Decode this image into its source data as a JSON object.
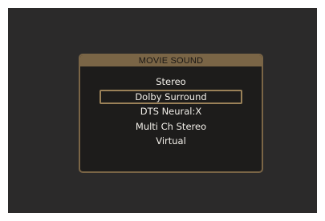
{
  "dialog": {
    "title": "MOVIE SOUND",
    "items": [
      {
        "label": "Stereo",
        "selected": false
      },
      {
        "label": "Dolby Surround",
        "selected": true
      },
      {
        "label": "DTS Neural:X",
        "selected": false
      },
      {
        "label": "Multi Ch Stereo",
        "selected": false
      },
      {
        "label": "Virtual",
        "selected": false
      }
    ]
  },
  "colors": {
    "screen_background": "#2b2a2a",
    "dialog_background": "#1d1c1b",
    "accent_frame": "#7a6546",
    "selection_border": "#9a8158",
    "item_text": "#f2efe9"
  }
}
